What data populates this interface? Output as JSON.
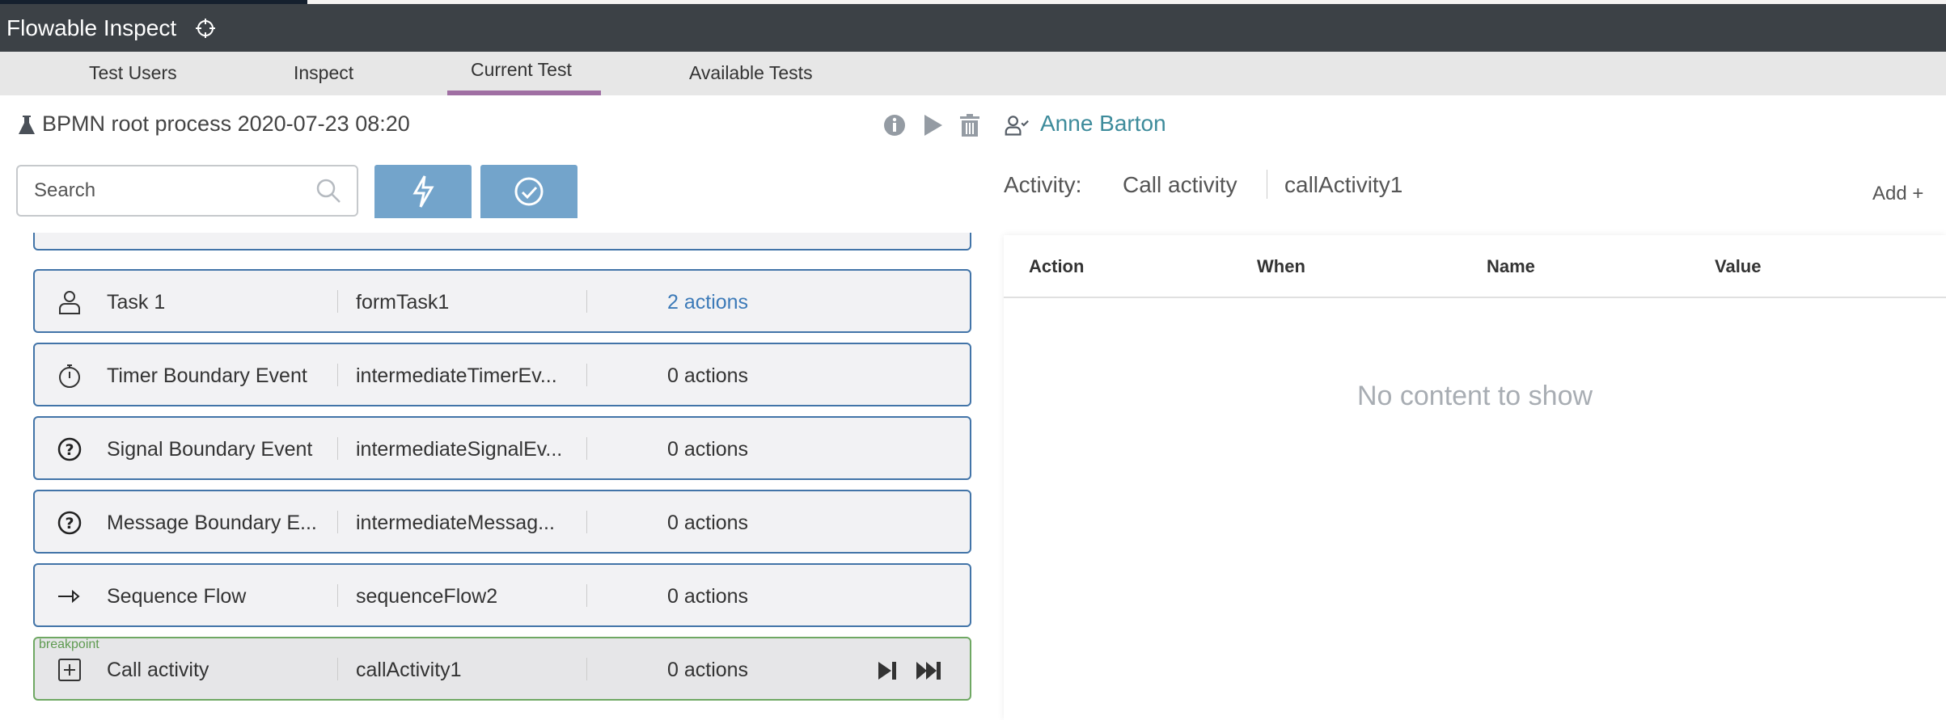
{
  "app": {
    "title": "Flowable Inspect",
    "title_icon": "crosshair-icon"
  },
  "tabs": [
    {
      "label": "Test Users"
    },
    {
      "label": "Inspect"
    },
    {
      "label": "Current Test",
      "active": true
    },
    {
      "label": "Available Tests"
    }
  ],
  "test": {
    "title": "BPMN root process 2020-07-23 08:20",
    "icon": "flask-icon",
    "actions": [
      "info-icon",
      "play-icon",
      "trash-icon"
    ]
  },
  "user": {
    "name": "Anne Barton",
    "icon": "user-check-icon"
  },
  "search": {
    "placeholder": "Search",
    "value": ""
  },
  "toolbar": {
    "buttons": [
      "lightning-icon",
      "check-circle-icon"
    ]
  },
  "rows": [
    {
      "icon": "user-icon",
      "label": "Task 1",
      "id": "formTask1",
      "actions": "2 actions",
      "link": true
    },
    {
      "icon": "timer-icon",
      "label": "Timer Boundary Event",
      "id": "intermediateTimerEv...",
      "actions": "0 actions"
    },
    {
      "icon": "question-icon",
      "label": "Signal Boundary Event",
      "id": "intermediateSignalEv...",
      "actions": "0 actions"
    },
    {
      "icon": "question-icon",
      "label": "Message Boundary E...",
      "id": "intermediateMessag...",
      "actions": "0 actions"
    },
    {
      "icon": "arrow-right-icon",
      "label": "Sequence Flow",
      "id": "sequenceFlow2",
      "actions": "0 actions"
    },
    {
      "icon": "plus-square-icon",
      "label": "Call activity",
      "id": "callActivity1",
      "actions": "0 actions",
      "breakpoint": "breakpoint",
      "controls": [
        "step-icon",
        "fast-forward-icon"
      ]
    }
  ],
  "activity": {
    "label": "Activity:",
    "name": "Call activity",
    "id": "callActivity1",
    "add_label": "Add +"
  },
  "table": {
    "headers": [
      "Action",
      "When",
      "Name",
      "Value"
    ],
    "empty": "No content to show"
  },
  "colors": {
    "appbar": "#3c4146",
    "accent": "#a06fa3",
    "button": "#73a4cb",
    "row_border": "#4274a8",
    "breakpoint": "#6fa863",
    "link": "#3d8b9b"
  }
}
